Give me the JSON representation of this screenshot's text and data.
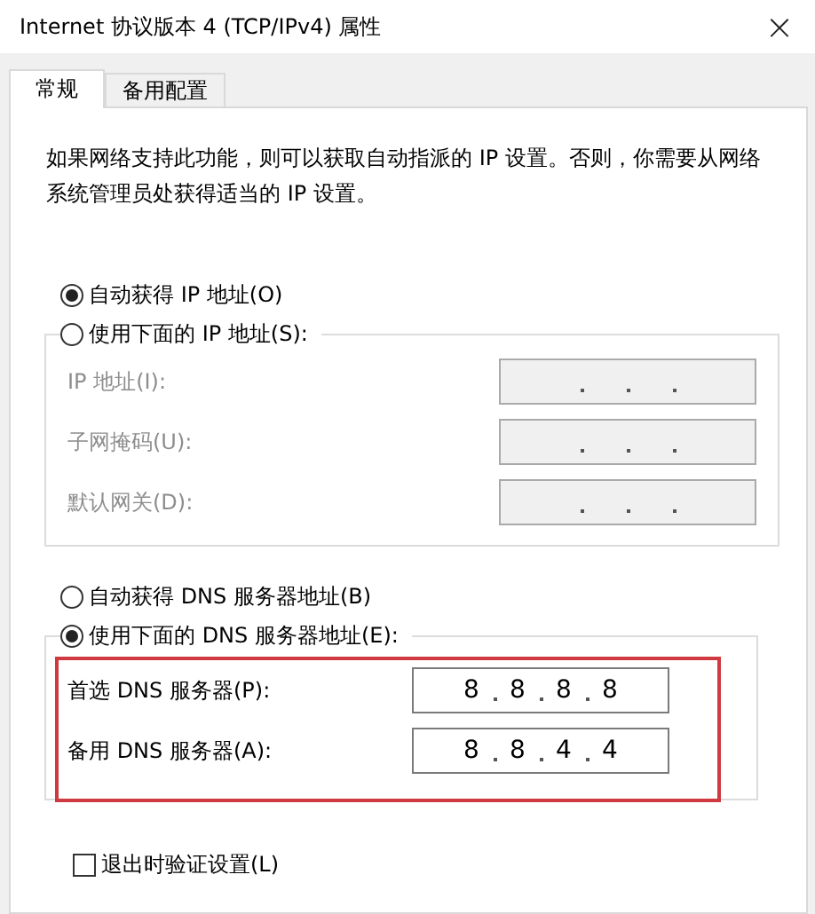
{
  "window": {
    "title": "Internet 协议版本 4 (TCP/IPv4) 属性",
    "close": "×"
  },
  "tabs": [
    {
      "label": "常规",
      "selected": true
    },
    {
      "label": "备用配置",
      "selected": false
    }
  ],
  "description": "如果网络支持此功能，则可以获取自动指派的 IP 设置。否则，你需要从网络系统管理员处获得适当的 IP 设置。",
  "ip": {
    "auto": {
      "label": "自动获得 IP 地址(O)",
      "selected": true
    },
    "manual": {
      "label": "使用下面的 IP 地址(S):",
      "selected": false
    },
    "fields": [
      {
        "label": "IP 地址(I):",
        "disabled": true
      },
      {
        "label": "子网掩码(U):",
        "disabled": true
      },
      {
        "label": "默认网关(D):",
        "disabled": true
      }
    ]
  },
  "dns": {
    "auto": {
      "label": "自动获得 DNS 服务器地址(B)",
      "selected": false
    },
    "manual": {
      "label": "使用下面的 DNS 服务器地址(E):",
      "selected": true
    },
    "highlighted": true,
    "fields": [
      {
        "label": "首选 DNS 服务器(P):",
        "disabled": false,
        "octets": [
          "8",
          "8",
          "8",
          "8"
        ]
      },
      {
        "label": "备用 DNS 服务器(A):",
        "disabled": false,
        "octets": [
          "8",
          "8",
          "4",
          "4"
        ]
      }
    ]
  },
  "validate": {
    "label": "退出时验证设置(L)",
    "checked": false
  }
}
